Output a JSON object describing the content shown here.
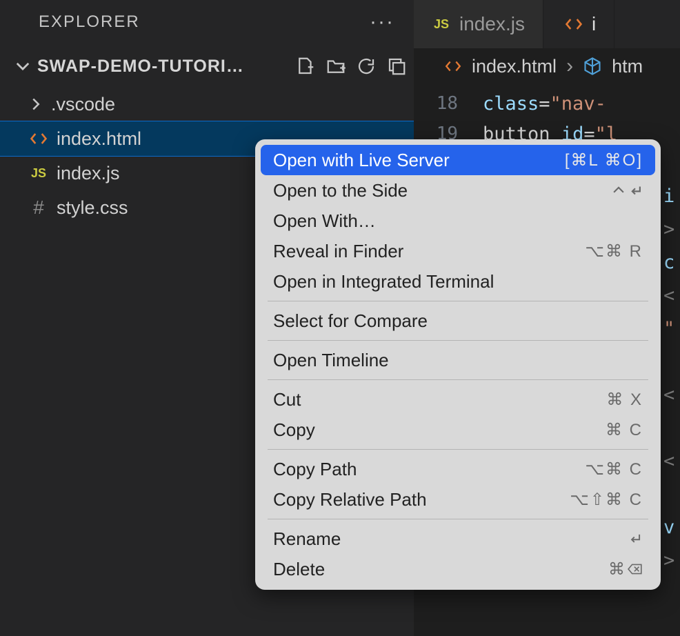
{
  "sidebar": {
    "title": "EXPLORER",
    "section": "SWAP-DEMO-TUTORI…",
    "items": [
      {
        "label": ".vscode",
        "type": "folder"
      },
      {
        "label": "index.html",
        "type": "html"
      },
      {
        "label": "index.js",
        "type": "js"
      },
      {
        "label": "style.css",
        "type": "css"
      }
    ]
  },
  "tabs": {
    "tab1": "index.js",
    "tab2": "i"
  },
  "breadcrumb": {
    "file": "index.html",
    "symbol": "htm"
  },
  "code": {
    "lines": [
      {
        "n": "18",
        "attr": "class",
        "op": "=",
        "str": "\"nav-"
      },
      {
        "n": "19",
        "attr": "button",
        "attr2": "id",
        "op": "=",
        "str": "\"l"
      }
    ]
  },
  "edge": [
    "i",
    ">",
    "c",
    "<",
    "\"",
    "",
    "<",
    "",
    "<",
    "",
    "v",
    ">"
  ],
  "menu": {
    "items": [
      {
        "label": "Open with Live Server",
        "shortcut": "[⌘L ⌘O]",
        "hl": true
      },
      {
        "label": "Open to the Side",
        "shortcut_icon": "split"
      },
      {
        "label": "Open With…"
      },
      {
        "label": "Reveal in Finder",
        "shortcut": "⌥⌘ R"
      },
      {
        "label": "Open in Integrated Terminal"
      }
    ],
    "group2": [
      {
        "label": "Select for Compare"
      }
    ],
    "group3": [
      {
        "label": "Open Timeline"
      }
    ],
    "group4": [
      {
        "label": "Cut",
        "shortcut": "⌘ X"
      },
      {
        "label": "Copy",
        "shortcut": "⌘ C"
      }
    ],
    "group5": [
      {
        "label": "Copy Path",
        "shortcut": "⌥⌘ C"
      },
      {
        "label": "Copy Relative Path",
        "shortcut": "⌥⇧⌘ C"
      }
    ],
    "group6": [
      {
        "label": "Rename",
        "shortcut_icon": "enter"
      },
      {
        "label": "Delete",
        "shortcut_icon": "delete"
      }
    ]
  }
}
